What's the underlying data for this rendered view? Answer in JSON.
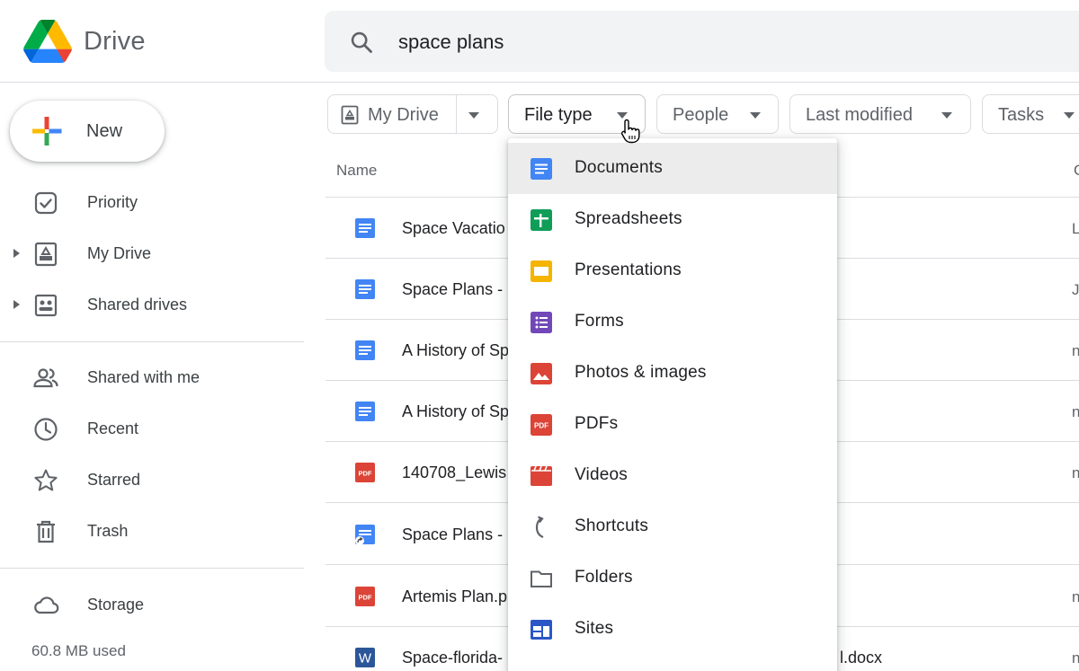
{
  "app": {
    "name": "Drive"
  },
  "search": {
    "value": "space plans"
  },
  "sidebar": {
    "new_label": "New",
    "items": [
      {
        "label": "Priority",
        "icon": "priority-icon"
      },
      {
        "label": "My Drive",
        "icon": "my-drive-icon"
      },
      {
        "label": "Shared drives",
        "icon": "shared-drives-icon"
      },
      {
        "label": "Shared with me",
        "icon": "shared-with-me-icon"
      },
      {
        "label": "Recent",
        "icon": "clock-icon"
      },
      {
        "label": "Starred",
        "icon": "star-icon"
      },
      {
        "label": "Trash",
        "icon": "trash-icon"
      },
      {
        "label": "Storage",
        "icon": "cloud-icon"
      }
    ],
    "storage_used": "60.8 MB used"
  },
  "filters": {
    "location": "My Drive",
    "file_type": "File type",
    "people": "People",
    "last_modified": "Last modified",
    "tasks": "Tasks"
  },
  "table": {
    "columns": {
      "name": "Name",
      "owner_partial": "C"
    },
    "rows": [
      {
        "name": "Space Vacatio",
        "type": "doc",
        "owner_partial": "L"
      },
      {
        "name": "Space Plans -",
        "type": "doc",
        "owner_partial": "J"
      },
      {
        "name": "A History of Sp",
        "type": "doc",
        "owner_partial": "n"
      },
      {
        "name": "A History of Sp",
        "type": "doc",
        "owner_partial": "n"
      },
      {
        "name": "140708_Lewis",
        "type": "pdf",
        "owner_partial": "n"
      },
      {
        "name": "Space Plans -",
        "type": "doc-shortcut",
        "owner_partial": ""
      },
      {
        "name": "Artemis Plan.p",
        "type": "pdf",
        "owner_partial": "n"
      },
      {
        "name": "Space-florida-",
        "type": "word",
        "tail": "l.docx",
        "owner_partial": "n"
      }
    ]
  },
  "file_type_menu": {
    "items": [
      {
        "label": "Documents",
        "icon": "docs-icon"
      },
      {
        "label": "Spreadsheets",
        "icon": "sheets-icon"
      },
      {
        "label": "Presentations",
        "icon": "slides-icon"
      },
      {
        "label": "Forms",
        "icon": "forms-icon"
      },
      {
        "label": "Photos & images",
        "icon": "image-icon"
      },
      {
        "label": "PDFs",
        "icon": "pdf-icon"
      },
      {
        "label": "Videos",
        "icon": "video-icon"
      },
      {
        "label": "Shortcuts",
        "icon": "shortcut-icon"
      },
      {
        "label": "Folders",
        "icon": "folder-icon"
      },
      {
        "label": "Sites",
        "icon": "sites-icon"
      }
    ]
  },
  "colors": {
    "docs_blue": "#4285f4",
    "sheets_green": "#0f9d58",
    "slides_yellow": "#f4b400",
    "forms_purple": "#7248b9",
    "red": "#db4437",
    "sites_navy": "#2a56c6",
    "menu_highlight": "#ececec"
  }
}
